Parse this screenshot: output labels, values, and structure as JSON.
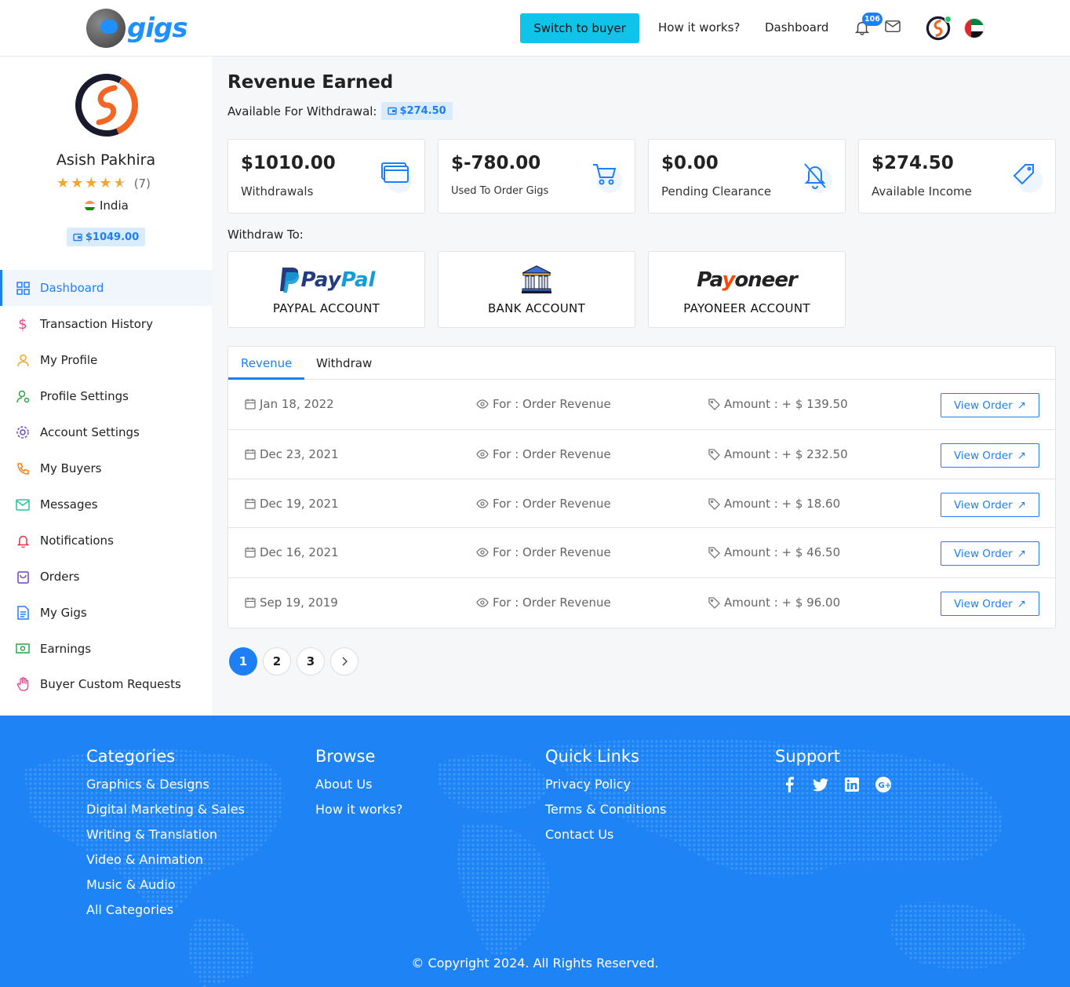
{
  "header": {
    "logo_text": "gigs",
    "switch_button": "Switch to buyer",
    "nav": [
      "How it works?",
      "Dashboard"
    ],
    "notification_count": "106",
    "accent": "#1e7ff5",
    "switch_color": "#10c3e8"
  },
  "profile": {
    "name": "Asish Pakhira",
    "rating": 4.5,
    "review_count": "(7)",
    "country": "India",
    "balance": "$1049.00"
  },
  "sidebar": {
    "items": [
      {
        "label": "Dashboard",
        "icon": "grid-icon",
        "color": "#1e7ff5",
        "active": true
      },
      {
        "label": "Transaction History",
        "icon": "dollar-icon",
        "color": "#e83e8c"
      },
      {
        "label": "My Profile",
        "icon": "user-icon",
        "color": "#f5a623"
      },
      {
        "label": "Profile Settings",
        "icon": "user-gear-icon",
        "color": "#28a745"
      },
      {
        "label": "Account Settings",
        "icon": "gear-icon",
        "color": "#6f42c1"
      },
      {
        "label": "My Buyers",
        "icon": "phone-icon",
        "color": "#fd7e14"
      },
      {
        "label": "Messages",
        "icon": "mail-icon",
        "color": "#20c997"
      },
      {
        "label": "Notifications",
        "icon": "bell-icon",
        "color": "#dc3545"
      },
      {
        "label": "Orders",
        "icon": "bag-icon",
        "color": "#6f42c1"
      },
      {
        "label": "My Gigs",
        "icon": "document-icon",
        "color": "#1e7ff5"
      },
      {
        "label": "Earnings",
        "icon": "money-icon",
        "color": "#28a745"
      },
      {
        "label": "Buyer Custom Requests",
        "icon": "hand-icon",
        "color": "#e83e8c"
      }
    ]
  },
  "main": {
    "title": "Revenue Earned",
    "available_label": "Available For Withdrawal:",
    "available_amount": "$274.50",
    "stats": [
      {
        "value": "$1010.00",
        "label": "Withdrawals",
        "icon": "wallet-icon"
      },
      {
        "value": "$-780.00",
        "label": "Used To Order Gigs",
        "icon": "cart-icon"
      },
      {
        "value": "$0.00",
        "label": "Pending Clearance",
        "icon": "bell-off-icon"
      },
      {
        "value": "$274.50",
        "label": "Available Income",
        "icon": "tag-icon"
      }
    ],
    "withdraw_to_label": "Withdraw To:",
    "methods": [
      {
        "logo": "PayPal",
        "label": "PAYPAL ACCOUNT"
      },
      {
        "logo": "",
        "label": "BANK ACCOUNT"
      },
      {
        "logo": "Payoneer",
        "label": "PAYONEER ACCOUNT"
      }
    ],
    "tabs": [
      "Revenue",
      "Withdraw"
    ],
    "transactions": [
      {
        "date": "Jan 18, 2022",
        "for": "For : Order Revenue",
        "amount": "Amount : + $ 139.50",
        "action": "View Order"
      },
      {
        "date": "Dec 23, 2021",
        "for": "For : Order Revenue",
        "amount": "Amount : + $ 232.50",
        "action": "View Order"
      },
      {
        "date": "Dec 19, 2021",
        "for": "For : Order Revenue",
        "amount": "Amount : + $ 18.60",
        "action": "View Order"
      },
      {
        "date": "Dec 16, 2021",
        "for": "For : Order Revenue",
        "amount": "Amount : + $ 46.50",
        "action": "View Order"
      },
      {
        "date": "Sep 19, 2019",
        "for": "For : Order Revenue",
        "amount": "Amount : + $ 96.00",
        "action": "View Order"
      }
    ],
    "pagination": [
      "1",
      "2",
      "3"
    ]
  },
  "footer": {
    "columns": [
      {
        "title": "Categories",
        "links": [
          "Graphics & Designs",
          "Digital Marketing & Sales",
          "Writing & Translation",
          "Video & Animation",
          "Music & Audio",
          "All Categories"
        ]
      },
      {
        "title": "Browse",
        "links": [
          "About Us",
          "How it works?"
        ]
      },
      {
        "title": "Quick Links",
        "links": [
          "Privacy Policy",
          "Terms & Conditions",
          "Contact Us"
        ]
      },
      {
        "title": "Support",
        "links": []
      }
    ],
    "socials": [
      "facebook-icon",
      "twitter-icon",
      "linkedin-icon",
      "google-plus-icon"
    ],
    "copyright": "© Copyright 2024. All Rights Reserved.",
    "background": "#1e84f5"
  }
}
